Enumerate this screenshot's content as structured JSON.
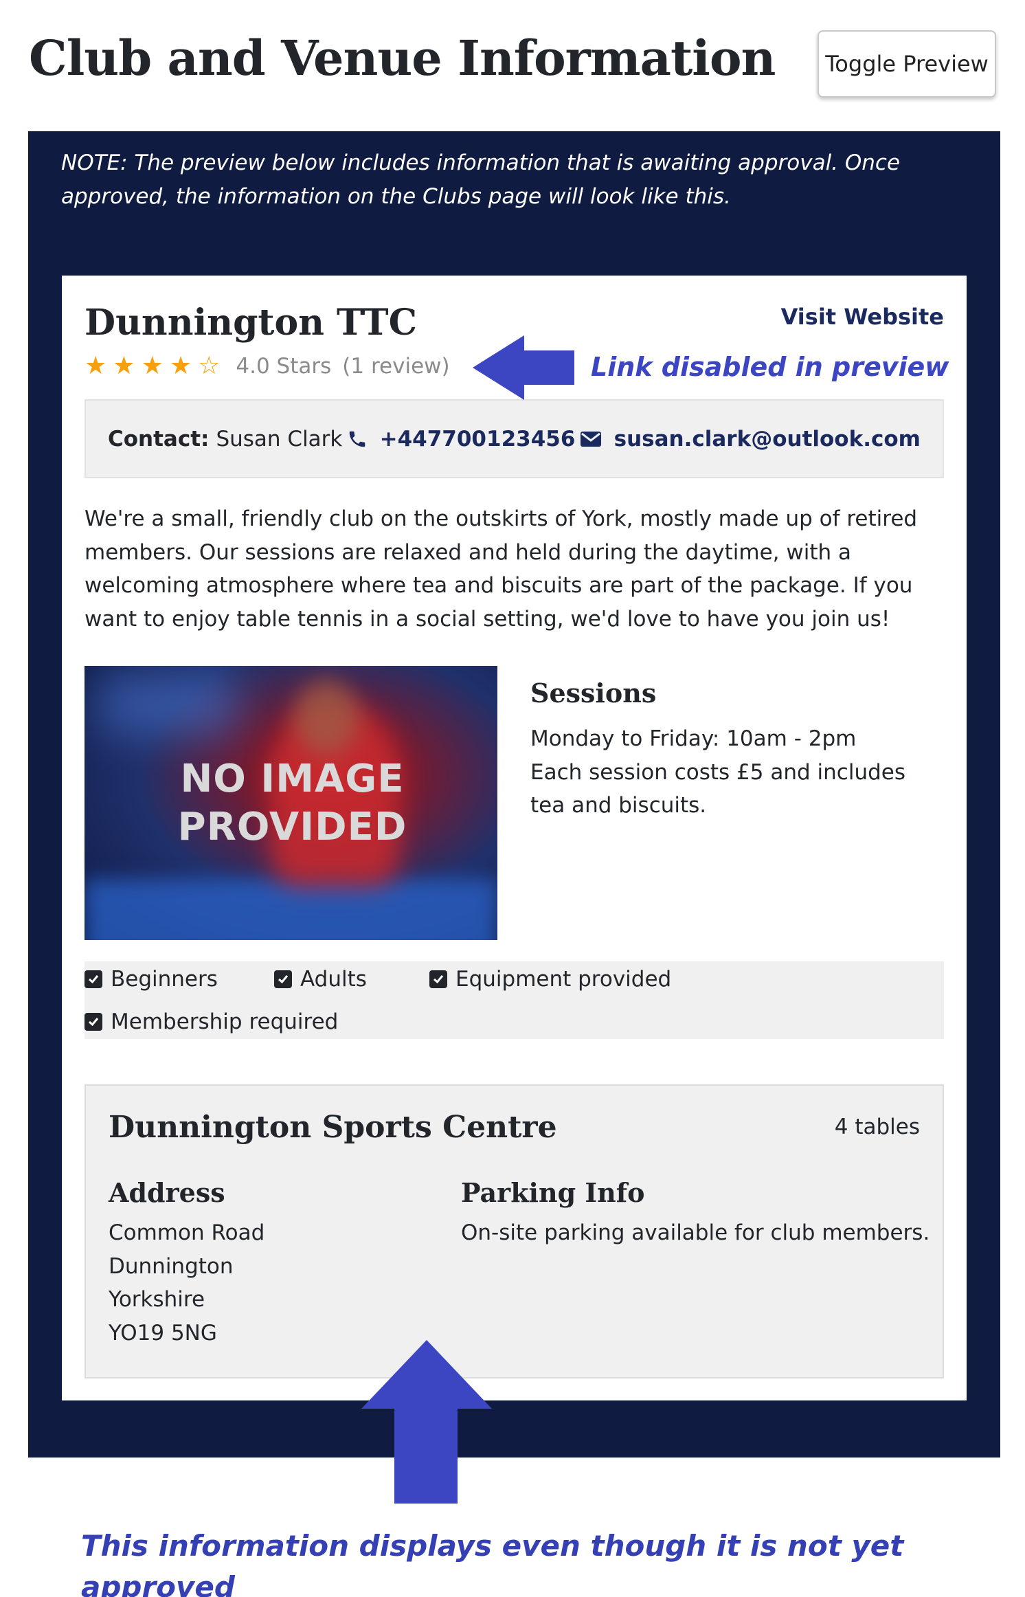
{
  "header": {
    "title": "Club and Venue Information",
    "toggle_label": "Toggle Preview"
  },
  "preview": {
    "note": "NOTE: The preview below includes information that is awaiting approval. Once approved, the information on the Clubs page will look like this."
  },
  "club": {
    "name": "Dunnington TTC",
    "visit_label": "Visit Website",
    "rating": {
      "value": 4,
      "max": 5,
      "label": "4.0 Stars",
      "reviews": "(1 review)"
    },
    "contact": {
      "label": "Contact:",
      "name": "Susan Clark",
      "phone": "+447700123456",
      "email": "susan.clark@outlook.com"
    },
    "description": "We're a small, friendly club on the outskirts of York, mostly made up of retired members. Our sessions are relaxed and held during the daytime, with a welcoming atmosphere where tea and biscuits are part of the package. If you want to enjoy table tennis in a social setting, we'd love to have you join us!",
    "image_placeholder": {
      "line1": "NO IMAGE",
      "line2": "PROVIDED"
    },
    "sessions": {
      "title": "Sessions",
      "line1": "Monday to Friday: 10am - 2pm",
      "line2": "Each session costs £5 and includes tea and biscuits."
    },
    "features": [
      {
        "label": "Beginners",
        "checked": true
      },
      {
        "label": "Adults",
        "checked": true
      },
      {
        "label": "Equipment provided",
        "checked": true
      },
      {
        "label": "Membership required",
        "checked": true
      }
    ]
  },
  "venue": {
    "name": "Dunnington Sports Centre",
    "tables": "4 tables",
    "address_heading": "Address",
    "address_lines": [
      "Common Road",
      "Dunnington",
      "Yorkshire",
      "YO19 5NG"
    ],
    "parking_heading": "Parking Info",
    "parking_text": "On-site parking available for club members."
  },
  "annotations": {
    "top": "Link disabled in preview",
    "bottom": "This information displays even though it is not yet approved",
    "color": "#3c46c2"
  },
  "colors": {
    "panel_bg": "#0f1b40",
    "star": "#f5a00c",
    "link": "#1b2a5e"
  },
  "icons": [
    "phone-icon",
    "envelope-icon",
    "star-icon",
    "checkbox-checked-icon",
    "arrow-left-icon",
    "arrow-up-icon"
  ]
}
